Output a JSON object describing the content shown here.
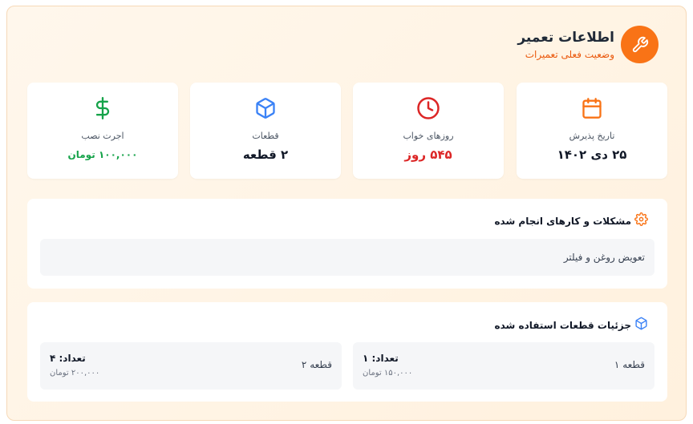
{
  "header": {
    "title": "اطلاعات تعمیر",
    "subtitle": "وضعیت فعلی تعمیرات",
    "icon": "wrench-icon",
    "accent": "#f97316"
  },
  "stats": [
    {
      "icon": "calendar-icon",
      "label": "تاریخ پذیرش",
      "value": "۲۵ دی ۱۴۰۲",
      "color": "#f97316"
    },
    {
      "icon": "clock-icon",
      "label": "روزهای خواب",
      "value": "۵۴۵ روز",
      "color": "#dc2626"
    },
    {
      "icon": "package-icon",
      "label": "قطعات",
      "value": "۲ قطعه",
      "color": "#3b82f6"
    },
    {
      "icon": "dollar-icon",
      "label": "اجرت نصب",
      "value": "۱۰۰,۰۰۰ تومان",
      "color": "#16a34a"
    }
  ],
  "issues": {
    "title": "مشکلات و کارهای انجام شده",
    "icon": "gear-icon",
    "text": "تعویض روغن و فیلتر"
  },
  "parts": {
    "title": "جزئیات قطعات استفاده شده",
    "icon": "package-icon",
    "items": [
      {
        "name": "قطعه ۱",
        "qty": "تعداد: ۱",
        "price": "۱۵۰,۰۰۰ تومان"
      },
      {
        "name": "قطعه ۲",
        "qty": "تعداد: ۴",
        "price": "۲۰۰,۰۰۰ تومان"
      }
    ]
  }
}
